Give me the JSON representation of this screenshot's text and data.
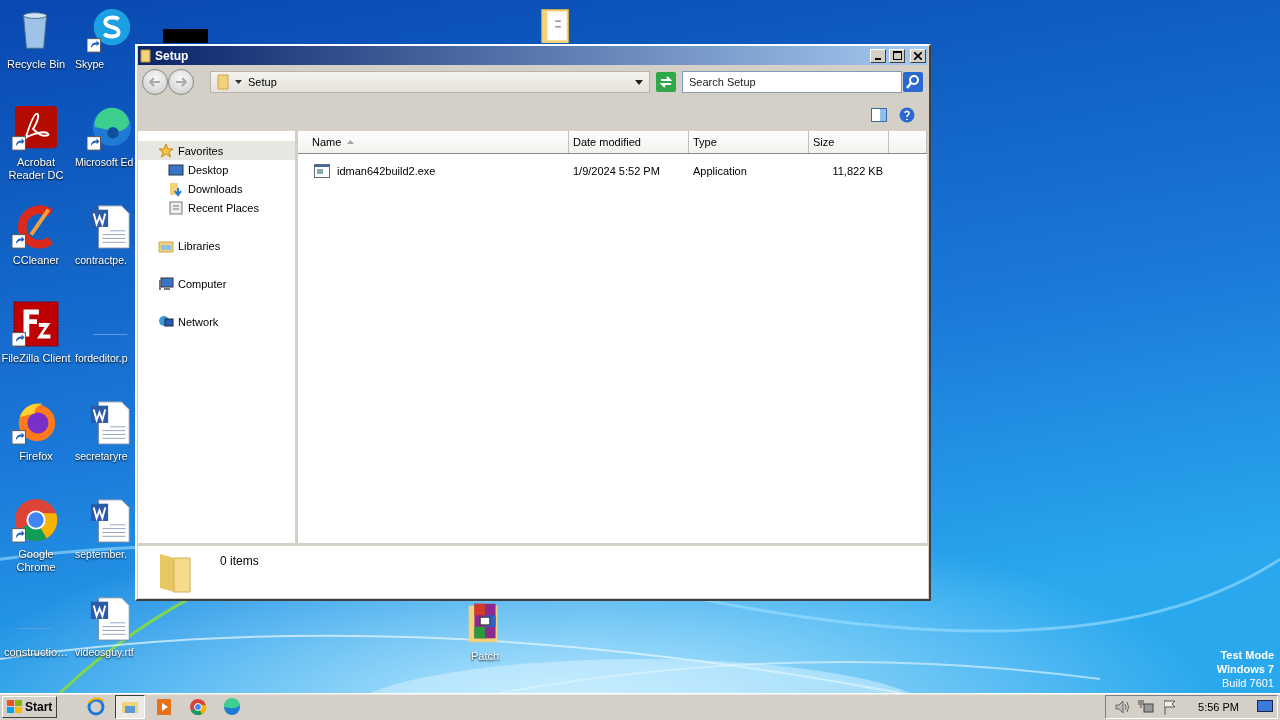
{
  "desktop": {
    "icons": [
      {
        "label": "Recycle Bin",
        "kind": "recycle",
        "shortcut": false
      },
      {
        "label": "Skype",
        "kind": "skype",
        "shortcut": true
      },
      {
        "label": "Acrobat Reader DC",
        "kind": "acrobat",
        "shortcut": true
      },
      {
        "label": "Microsoft Ed",
        "kind": "edge",
        "shortcut": true
      },
      {
        "label": "CCleaner",
        "kind": "ccleaner",
        "shortcut": true
      },
      {
        "label": "contractpe.",
        "kind": "word",
        "shortcut": false
      },
      {
        "label": "FileZilla Client",
        "kind": "filezilla",
        "shortcut": true
      },
      {
        "label": "fordeditor.p",
        "kind": "blank",
        "shortcut": false
      },
      {
        "label": "Firefox",
        "kind": "firefox",
        "shortcut": true
      },
      {
        "label": "secretaryre",
        "kind": "word",
        "shortcut": false
      },
      {
        "label": "Google Chrome",
        "kind": "chrome",
        "shortcut": true
      },
      {
        "label": "september.",
        "kind": "word",
        "shortcut": false
      },
      {
        "label": "constructio…",
        "kind": "blank",
        "shortcut": false
      },
      {
        "label": "videosguy.rtf",
        "kind": "word",
        "shortcut": false
      },
      {
        "label": "Patch",
        "kind": "archive",
        "shortcut": false
      },
      {
        "kind": "folder",
        "shortcut": false
      }
    ],
    "os_notice": [
      "Test Mode",
      "Windows 7",
      "Build 7601"
    ]
  },
  "window": {
    "title": "Setup",
    "address": "Setup",
    "search": {
      "placeholder": "Search Setup"
    },
    "nav": [
      {
        "label": "Favorites",
        "kind": "favorites",
        "selected": true,
        "children": [
          {
            "label": "Desktop",
            "kind": "desktop",
            "selected": false
          },
          {
            "label": "Downloads",
            "kind": "downloads",
            "selected": false
          },
          {
            "label": "Recent Places",
            "kind": "recent",
            "selected": false
          }
        ]
      },
      {
        "label": "Libraries",
        "kind": "libraries",
        "selected": false
      },
      {
        "label": "Computer",
        "kind": "computer",
        "selected": false
      },
      {
        "label": "Network",
        "kind": "network",
        "selected": false
      }
    ],
    "columns": [
      {
        "label": "Name",
        "sorted": true
      },
      {
        "label": "Date modified",
        "sorted": false
      },
      {
        "label": "Type",
        "sorted": false
      },
      {
        "label": "Size",
        "sorted": false
      }
    ],
    "rows": [
      {
        "name": "idman642build2.exe",
        "date": "1/9/2024 5:52 PM",
        "type": "Application",
        "size": "11,822 KB",
        "selected": false
      }
    ],
    "status": "0 items"
  },
  "taskbar": {
    "start": "Start",
    "apps": [
      {
        "kind": "ie",
        "selected": false
      },
      {
        "kind": "explorer",
        "selected": true
      },
      {
        "kind": "media",
        "selected": false
      },
      {
        "kind": "chrome",
        "selected": false
      },
      {
        "kind": "edge",
        "selected": false
      }
    ],
    "time": "5:56 PM"
  }
}
